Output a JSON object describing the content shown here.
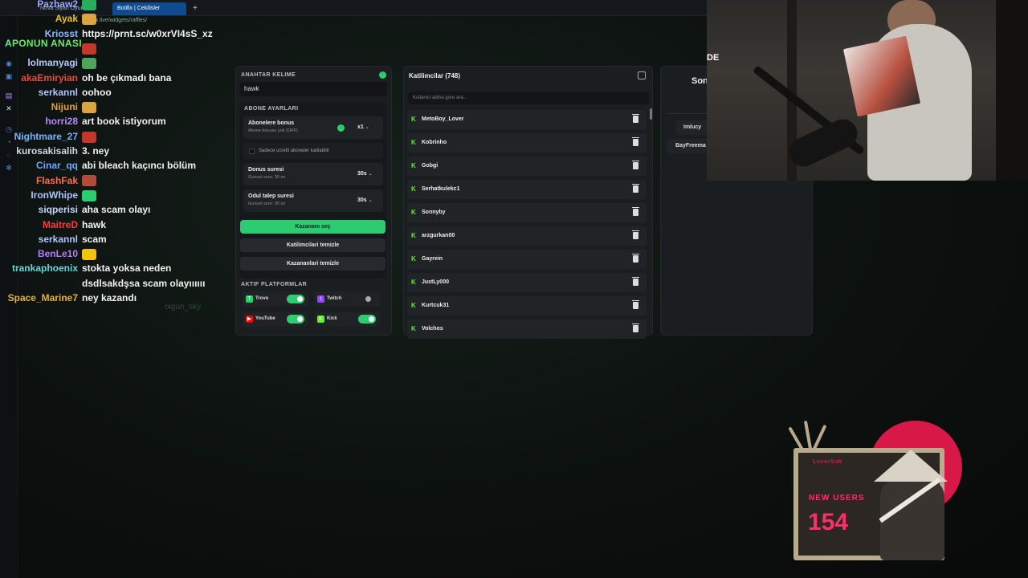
{
  "browser": {
    "tabs": [
      {
        "label": "Nova Siyan Oyunu..."
      },
      {
        "label": "Botifix | Cekilisler"
      }
    ],
    "url": "botifix.live/widgets/raffles/"
  },
  "overlay_tag": "APONUN ANASI",
  "chat": [
    {
      "user": "Pazhaw2",
      "color": "#9aa7ff",
      "msg": "",
      "emote": "#27ae60"
    },
    {
      "user": "Ayak",
      "color": "#f0c419",
      "msg": "",
      "emote": "#d9a441"
    },
    {
      "user": "Kriosst",
      "color": "#8fb8ff",
      "msg": "https://prnt.sc/w0xrVI4sS_xz",
      "emote": ""
    },
    {
      "user": "",
      "color": "#ffffff",
      "msg": "",
      "emote": "#c0392b"
    },
    {
      "user": "lolmanyagi",
      "color": "#b8c9ff",
      "msg": "",
      "emote": "#4fa35a"
    },
    {
      "user": "akaEmiryian",
      "color": "#e74c3c",
      "msg": "oh be çıkmadı bana",
      "emote": ""
    },
    {
      "user": "serkannl",
      "color": "#b0c4ff",
      "msg": "oohoo",
      "emote": ""
    },
    {
      "user": "Nijuni",
      "color": "#e0a23b",
      "msg": "",
      "emote": "#d9a441"
    },
    {
      "user": "horri28",
      "color": "#b48cff",
      "msg": "art book istiyorum",
      "emote": ""
    },
    {
      "user": "Nightmare_27",
      "color": "#7ab3ff",
      "msg": "",
      "emote": "#c0392b"
    },
    {
      "user": "kurosakisalih",
      "color": "#d0d7de",
      "msg": "3. ney",
      "emote": ""
    },
    {
      "user": "Cinar_qq",
      "color": "#6fa8ff",
      "msg": "abi bleach kaçıncı bölüm",
      "emote": ""
    },
    {
      "user": "FlashFak",
      "color": "#ff6b4a",
      "msg": "",
      "emote": "#b34b3b"
    },
    {
      "user": "IronWhipe",
      "color": "#a9c4ff",
      "msg": "",
      "emote": "#2ecc71"
    },
    {
      "user": "siqperisi",
      "color": "#c8d6ff",
      "msg": "aha scam olayı",
      "emote": ""
    },
    {
      "user": "MaitreD",
      "color": "#ff3b3b",
      "msg": "hawk",
      "emote": ""
    },
    {
      "user": "serkannl",
      "color": "#b0c4ff",
      "msg": "scam",
      "emote": ""
    },
    {
      "user": "BenLe10",
      "color": "#b37bff",
      "msg": "",
      "emote": "#f1c40f"
    },
    {
      "user": "trankaphoenix",
      "color": "#6ad5d5",
      "msg": "stokta yoksa neden",
      "emote": ""
    },
    {
      "user": "",
      "color": "#ffffff",
      "msg": "dsdlsakdşsa scam olayıııııı",
      "emote": ""
    },
    {
      "user": "Space_Marine7",
      "color": "#e3b23c",
      "msg": "ney kazandı",
      "emote": ""
    }
  ],
  "ghost_name": "olgun_sky",
  "settings": {
    "keyword_title": "ANAHTAR KELIME",
    "keyword_value": "hawk",
    "sub_title": "ABONE AYARLARI",
    "sub_bonus_label": "Abonelere bonus",
    "sub_bonus_sub": "Abone bonusu yok (OFF)",
    "sub_bonus_value": "x1",
    "paid_only_label": "Sadece ucretli aboneler katilabilir",
    "bonus_time_label": "Donus suresi",
    "bonus_time_sub": "Guncel sure: 30 sn",
    "bonus_time_value": "30s",
    "claim_time_label": "Odul talep suresi",
    "claim_time_sub": "Guncel sure: 30 sn",
    "claim_time_value": "30s",
    "btn_pick": "Kazananı seç",
    "btn_clear_participants": "Katilimcilari temizle",
    "btn_clear_winners": "Kazananlari temizle",
    "platforms_title": "AKTIF PLATFORMLAR",
    "platforms": [
      {
        "name": "Trovo",
        "on": true,
        "color": "#19d66b",
        "glyph": "T"
      },
      {
        "name": "Twitch",
        "on": false,
        "color": "#9146ff",
        "glyph": "t"
      },
      {
        "name": "YouTube",
        "on": true,
        "color": "#ff0000",
        "glyph": "▶"
      },
      {
        "name": "Kick",
        "on": true,
        "color": "#53fc18",
        "glyph": "K"
      }
    ]
  },
  "participants": {
    "title": "Katilimcilar (748)",
    "search_placeholder": "Kullanici adina gore ara...",
    "list": [
      "MetoBoy_Lover",
      "Kobrinho",
      "Gobgi",
      "Serhatkulekc1",
      "Sonnyby",
      "arzgurkan00",
      "Gayrein",
      "JustLy000",
      "Kurtcuk31",
      "Volchos"
    ]
  },
  "winners": {
    "title": "Son",
    "items": [
      "Imlucy",
      "BayFreema"
    ]
  },
  "webcam_text": "DE",
  "widget": {
    "logo": "LuxorSub",
    "label": "NEW USERS",
    "count": "154"
  }
}
